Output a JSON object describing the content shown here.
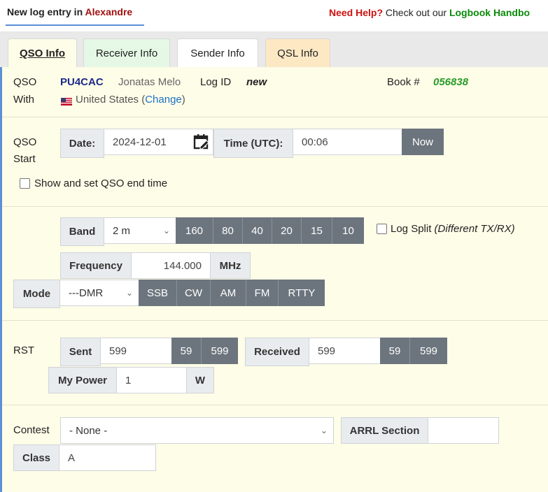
{
  "header": {
    "title_prefix": "New log entry in ",
    "title_name": "Alexandre",
    "help_need": "Need Help?",
    "help_text": " Check out our ",
    "help_link": "Logbook Handbo"
  },
  "tabs": [
    "QSO Info",
    "Receiver Info",
    "Sender Info",
    "QSL Info"
  ],
  "qso_with": {
    "label_line1": "QSO",
    "label_line2": "With",
    "callsign": "PU4CAC",
    "name": "Jonatas Melo",
    "log_id_label": "Log ID",
    "log_id_value": "new",
    "book_label": "Book #",
    "book_value": "056838",
    "flag": "us-flag-icon",
    "country": "United States (",
    "change_link": "Change",
    "country_close": ")"
  },
  "qso_start": {
    "label_line1": "QSO",
    "label_line2": "Start",
    "date_label": "Date:",
    "date_value": "2024-12-01",
    "time_label": "Time (UTC):",
    "time_value": "00:06",
    "now_button": "Now",
    "end_time_checkbox": "Show and set QSO end time"
  },
  "band": {
    "label": "Band",
    "selected": "2 m",
    "buttons": [
      "160",
      "80",
      "40",
      "20",
      "15",
      "10"
    ],
    "log_split_label": "Log Split",
    "log_split_hint": "(Different TX/RX)",
    "frequency_label": "Frequency",
    "frequency_value": "144.000",
    "frequency_unit": "MHz",
    "mode_label": "Mode",
    "mode_selected": "---DMR",
    "mode_buttons": [
      "SSB",
      "CW",
      "AM",
      "FM",
      "RTTY"
    ]
  },
  "rst": {
    "label": "RST",
    "sent_label": "Sent",
    "sent_value": "599",
    "sent_buttons": [
      "59",
      "599"
    ],
    "received_label": "Received",
    "received_value": "599",
    "received_buttons": [
      "59",
      "599"
    ],
    "power_label": "My Power",
    "power_value": "1",
    "power_unit": "W"
  },
  "contest": {
    "label": "Contest",
    "selected": "- None -",
    "arrl_label": "ARRL Section",
    "arrl_value": "",
    "class_label": "Class",
    "class_value": "A"
  },
  "colors": {
    "form_bg": "#fefde8",
    "button_gray": "#6c757d",
    "accent_blue": "#5b8fd8",
    "help_red": "#d01010",
    "link_green": "#0a8a0a"
  }
}
